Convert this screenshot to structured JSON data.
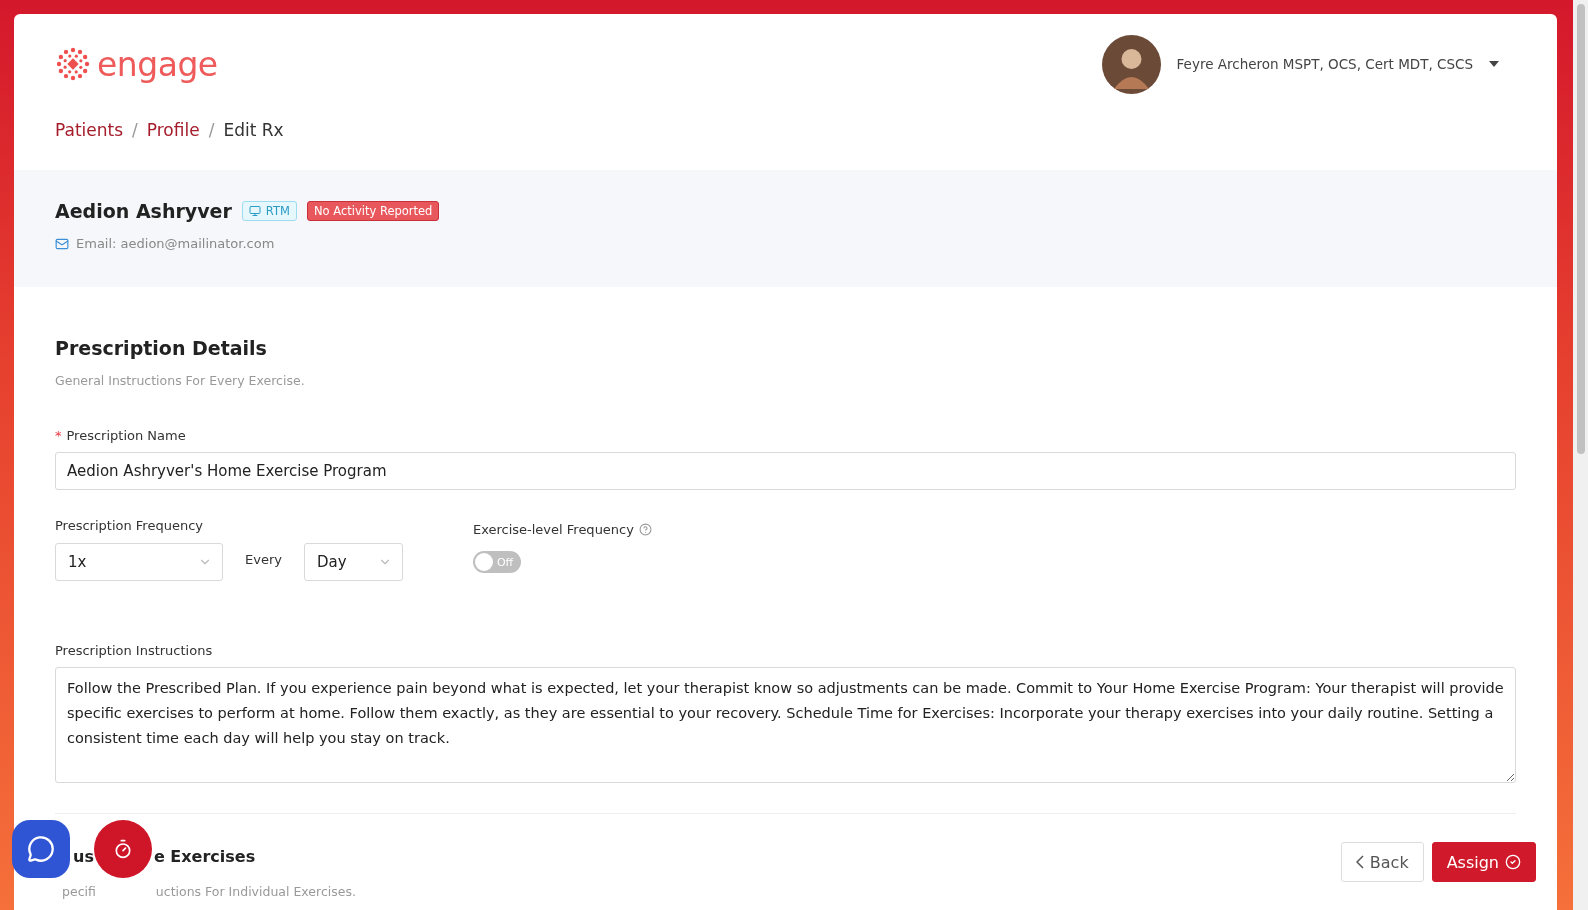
{
  "logo": {
    "text": "engage"
  },
  "user": {
    "name": "Feyre Archeron MSPT, OCS, Cert MDT, CSCS"
  },
  "breadcrumb": [
    {
      "label": "Patients",
      "link": true
    },
    {
      "label": "Profile",
      "link": true
    },
    {
      "label": "Edit Rx",
      "link": false
    }
  ],
  "separator": "/",
  "patient": {
    "name": "Aedion Ashryver",
    "tags": [
      {
        "kind": "program",
        "label": "RTM"
      },
      {
        "kind": "alert",
        "label": "No Activity Reported"
      }
    ],
    "email": "Email: aedion@mailinator.com"
  },
  "prescription": {
    "title": "Prescription Details",
    "subtitle": "General Instructions For Every Exercise.",
    "name_field": {
      "label": "Prescription Name",
      "required": true,
      "required_mark": "*",
      "value": "Aedion Ashryver's Home Exercise Program"
    },
    "frequency": {
      "label": "Prescription Frequency",
      "count": "1x",
      "every": "Every",
      "period": "Day"
    },
    "exercise_level": {
      "label": "Exercise-level Frequency",
      "on": false,
      "state_text": "Off"
    },
    "instructions": {
      "label": "Prescription Instructions",
      "value": "Follow the Prescribed Plan. If you experience pain beyond what is expected, let your therapist know so adjustments can be made. Commit to Your Home Exercise Program: Your therapist will provide specific exercises to perform at home. Follow them exactly, as they are essential to your recovery. Schedule Time for Exercises: Incorporate your therapy exercises into your daily routine. Setting a consistent time each day will help you stay on track."
    }
  },
  "exercises": {
    "title_parts": [
      "us",
      "e Exercises"
    ],
    "subtitle_parts": [
      "pecifi",
      "uctions For Individual Exercises."
    ]
  },
  "buttons": [
    {
      "kind": "back",
      "label": "Back"
    },
    {
      "kind": "primary",
      "label": "Assign"
    }
  ]
}
